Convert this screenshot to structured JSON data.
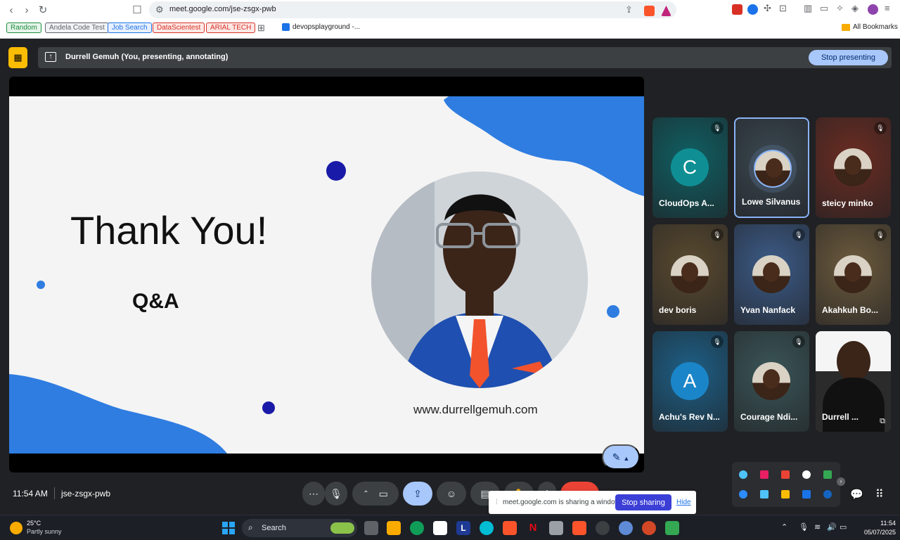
{
  "browser": {
    "url": "meet.google.com/jse-zsgx-pwb",
    "bookmarks": [
      {
        "label": "Random",
        "color": "#1e8e3e",
        "bg": "#e6f4ea"
      },
      {
        "label": "Andela Code Test",
        "color": "#5f6368",
        "bg": "#f1f3f4"
      },
      {
        "label": "Job Search",
        "color": "#1a73e8",
        "bg": "#e8f0fe"
      },
      {
        "label": "DataScientest",
        "color": "#d93025",
        "bg": "#fce8e6"
      },
      {
        "label": "ARIAL TECH",
        "color": "#d93025",
        "bg": "#fce8e6"
      }
    ],
    "bookmark_link": "devopsplayground -...",
    "all_bookmarks": "All Bookmarks"
  },
  "presenting_bar": {
    "text": "Durrell Gemuh (You, presenting, annotating)",
    "stop_label": "Stop presenting"
  },
  "slide": {
    "heading": "Thank You!",
    "subheading": "Q&A",
    "website": "www.durrellgemuh.com",
    "accent_color": "#2f7de1",
    "dot_color": "#1a1aa8"
  },
  "participants": [
    {
      "name": "CloudOps A...",
      "avatar_letter": "C",
      "muted": true,
      "bg": "#0f5f63",
      "avatar_bg": "#0f8f93"
    },
    {
      "name": "Lowe Silvanus",
      "avatar_letter": "",
      "muted": false,
      "bg": "#3a4750",
      "active": true
    },
    {
      "name": "steicy minko",
      "avatar_letter": "",
      "muted": true,
      "bg": "#6b2c22"
    },
    {
      "name": "dev boris",
      "avatar_letter": "",
      "muted": true,
      "bg": "#5a4a2f"
    },
    {
      "name": "Yvan Nanfack",
      "avatar_letter": "",
      "muted": true,
      "bg": "#3c5b87"
    },
    {
      "name": "Akahkuh Bo...",
      "avatar_letter": "",
      "muted": true,
      "bg": "#6c5a3c"
    },
    {
      "name": "Achu's Rev N...",
      "avatar_letter": "A",
      "muted": true,
      "bg": "#1d5f86",
      "avatar_bg": "#1a86c9"
    },
    {
      "name": "Courage Ndi...",
      "avatar_letter": "",
      "muted": true,
      "bg": "#3a5557"
    },
    {
      "name": "Durrell ...",
      "avatar_letter": "",
      "muted": false,
      "bg": "#f2f2f2",
      "self_view": true
    }
  ],
  "meeting": {
    "time": "11:54 AM",
    "code": "jse-zsgx-pwb"
  },
  "share_banner": {
    "text": "meet.google.com is sharing a window.",
    "stop_label": "Stop sharing",
    "hide_label": "Hide"
  },
  "taskbar": {
    "temperature": "25°C",
    "weather": "Partly sunny",
    "search_placeholder": "Search",
    "clock": "11:54",
    "date": "05/07/2025"
  }
}
